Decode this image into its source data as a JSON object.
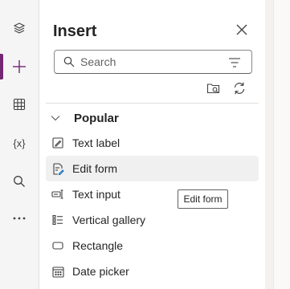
{
  "rail": {
    "items": [
      {
        "icon": "layers-icon"
      },
      {
        "icon": "plus-icon",
        "active": true
      },
      {
        "icon": "table-icon"
      },
      {
        "icon": "variables-icon",
        "label": "{x}"
      },
      {
        "icon": "search-icon"
      },
      {
        "icon": "more-icon"
      }
    ],
    "accent_color": "#742774"
  },
  "panel": {
    "title": "Insert",
    "search": {
      "placeholder": "Search",
      "value": ""
    },
    "section": {
      "label": "Popular",
      "items": [
        {
          "label": "Text label",
          "icon": "text-label-icon"
        },
        {
          "label": "Edit form",
          "icon": "edit-form-icon",
          "hovered": true
        },
        {
          "label": "Text input",
          "icon": "text-input-icon"
        },
        {
          "label": "Vertical gallery",
          "icon": "vertical-gallery-icon"
        },
        {
          "label": "Rectangle",
          "icon": "rectangle-icon"
        },
        {
          "label": "Date picker",
          "icon": "date-picker-icon"
        }
      ]
    }
  },
  "tooltip": {
    "text": "Edit form"
  }
}
